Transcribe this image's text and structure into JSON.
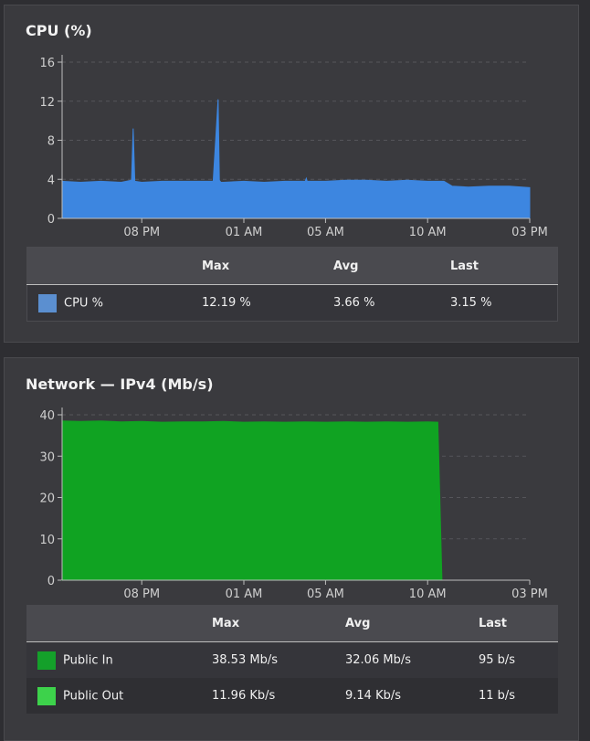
{
  "cpu_panel": {
    "title": "CPU (%)",
    "table": {
      "headers": [
        "",
        "Max",
        "Avg",
        "Last"
      ],
      "rows": [
        {
          "name": "CPU %",
          "color": "#5b8fd0",
          "max": "12.19 %",
          "avg": "3.66 %",
          "last": "3.15 %"
        }
      ]
    }
  },
  "network_panel": {
    "title": "Network — IPv4 (Mb/s)",
    "table": {
      "headers": [
        "",
        "Max",
        "Avg",
        "Last"
      ],
      "rows": [
        {
          "name": "Public In",
          "color": "#14a02a",
          "max": "38.53 Mb/s",
          "avg": "32.06 Mb/s",
          "last": "95 b/s"
        },
        {
          "name": "Public Out",
          "color": "#3dd24b",
          "max": "11.96 Kb/s",
          "avg": "9.14 Kb/s",
          "last": "11 b/s"
        }
      ]
    }
  },
  "chart_data": [
    {
      "type": "area",
      "title": "CPU (%)",
      "x_tick_labels": [
        "08 PM",
        "01 AM",
        "05 AM",
        "10 AM",
        "03 PM"
      ],
      "x_tick_hours": [
        20,
        25,
        29,
        34,
        39
      ],
      "x_range_hours": [
        16.1,
        39.0
      ],
      "ylim": [
        0,
        16
      ],
      "y_ticks": [
        0,
        4,
        8,
        12,
        16
      ],
      "grid": true,
      "series": [
        {
          "name": "CPU %",
          "color": "#3d86e0",
          "x_hours": [
            16.1,
            17.0,
            18.0,
            19.0,
            19.5,
            19.58,
            19.66,
            20.0,
            21.0,
            22.0,
            23.0,
            23.5,
            23.74,
            23.8,
            23.88,
            24.0,
            25.0,
            26.0,
            27.0,
            28.0,
            28.06,
            28.1,
            29.0,
            30.0,
            31.0,
            32.0,
            33.0,
            34.0,
            34.8,
            35.2,
            36.0,
            37.0,
            38.0,
            39.0
          ],
          "values": [
            3.8,
            3.7,
            3.8,
            3.7,
            3.9,
            9.2,
            3.8,
            3.7,
            3.8,
            3.8,
            3.8,
            3.8,
            12.19,
            3.9,
            3.7,
            3.7,
            3.8,
            3.7,
            3.8,
            3.8,
            4.1,
            3.8,
            3.8,
            3.9,
            3.9,
            3.8,
            3.9,
            3.8,
            3.8,
            3.3,
            3.2,
            3.3,
            3.3,
            3.15
          ]
        }
      ]
    },
    {
      "type": "area",
      "title": "Network — IPv4 (Mb/s)",
      "x_tick_labels": [
        "08 PM",
        "01 AM",
        "05 AM",
        "10 AM",
        "03 PM"
      ],
      "x_tick_hours": [
        20,
        25,
        29,
        34,
        39
      ],
      "x_range_hours": [
        16.1,
        39.0
      ],
      "ylim": [
        0,
        40
      ],
      "y_ticks": [
        0,
        10,
        20,
        30,
        40
      ],
      "grid": true,
      "series": [
        {
          "name": "Public In",
          "color": "#10a322",
          "x_hours": [
            16.1,
            17.0,
            18.0,
            19.0,
            20.0,
            21.0,
            22.0,
            23.0,
            24.0,
            25.0,
            26.0,
            27.0,
            28.0,
            29.0,
            30.0,
            31.0,
            32.0,
            33.0,
            34.0,
            34.5,
            34.7,
            39.0
          ],
          "values": [
            38.5,
            38.4,
            38.5,
            38.3,
            38.4,
            38.2,
            38.3,
            38.3,
            38.4,
            38.2,
            38.3,
            38.2,
            38.3,
            38.2,
            38.3,
            38.2,
            38.3,
            38.2,
            38.3,
            38.2,
            0.0,
            0.0
          ]
        },
        {
          "name": "Public Out",
          "color": "#3dd24b",
          "x_hours": [
            16.1,
            39.0
          ],
          "values": [
            0.01,
            0.01
          ]
        }
      ]
    }
  ]
}
